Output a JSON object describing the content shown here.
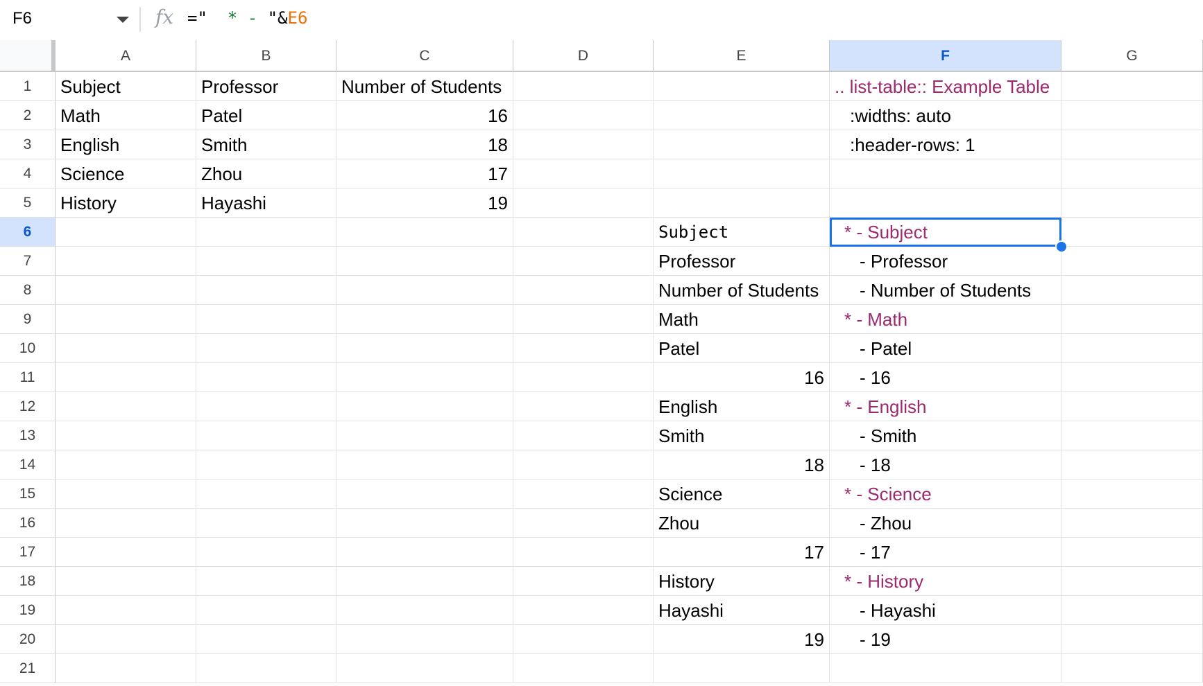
{
  "formula_bar": {
    "name_box": "F6",
    "fx_label": "fx",
    "formula_eq": "=\"",
    "formula_star": "  * - ",
    "formula_quote_amp": "\"&",
    "formula_ref": "E6"
  },
  "columns": [
    "A",
    "B",
    "C",
    "D",
    "E",
    "F",
    "G"
  ],
  "rows": [
    "1",
    "2",
    "3",
    "4",
    "5",
    "6",
    "7",
    "8",
    "9",
    "10",
    "11",
    "12",
    "13",
    "14",
    "15",
    "16",
    "17",
    "18",
    "19",
    "20",
    "21"
  ],
  "cells": {
    "A1": "Subject",
    "B1": "Professor",
    "C1": "Number of Students",
    "F1": ".. list-table:: Example Table",
    "A2": "Math",
    "B2": "Patel",
    "C2": "16",
    "F2": ":widths: auto",
    "A3": "English",
    "B3": "Smith",
    "C3": "18",
    "F3": ":header-rows: 1",
    "A4": "Science",
    "B4": "Zhou",
    "C4": "17",
    "A5": "History",
    "B5": "Hayashi",
    "C5": "19",
    "E6": "Subject",
    "F6": "* - Subject",
    "E7": "Professor",
    "F7": "- Professor",
    "E8": "Number of Students",
    "F8": "- Number of Students",
    "E9": "Math",
    "F9": "* - Math",
    "E10": "Patel",
    "F10": "- Patel",
    "E11": "16",
    "F11": "- 16",
    "E12": "English",
    "F12": "* - English",
    "E13": "Smith",
    "F13": "- Smith",
    "E14": "18",
    "F14": "- 18",
    "E15": "Science",
    "F15": "* - Science",
    "E16": "Zhou",
    "F16": "- Zhou",
    "E17": "17",
    "F17": "- 17",
    "E18": "History",
    "F18": "* - History",
    "E19": "Hayashi",
    "F19": "- Hayashi",
    "E20": "19",
    "F20": "- 19"
  },
  "selected_cell": "F6",
  "colors": {
    "accent": "#1a73e8",
    "purple_text": "#9c2a6e",
    "header_selected_bg": "#d3e3fd"
  }
}
